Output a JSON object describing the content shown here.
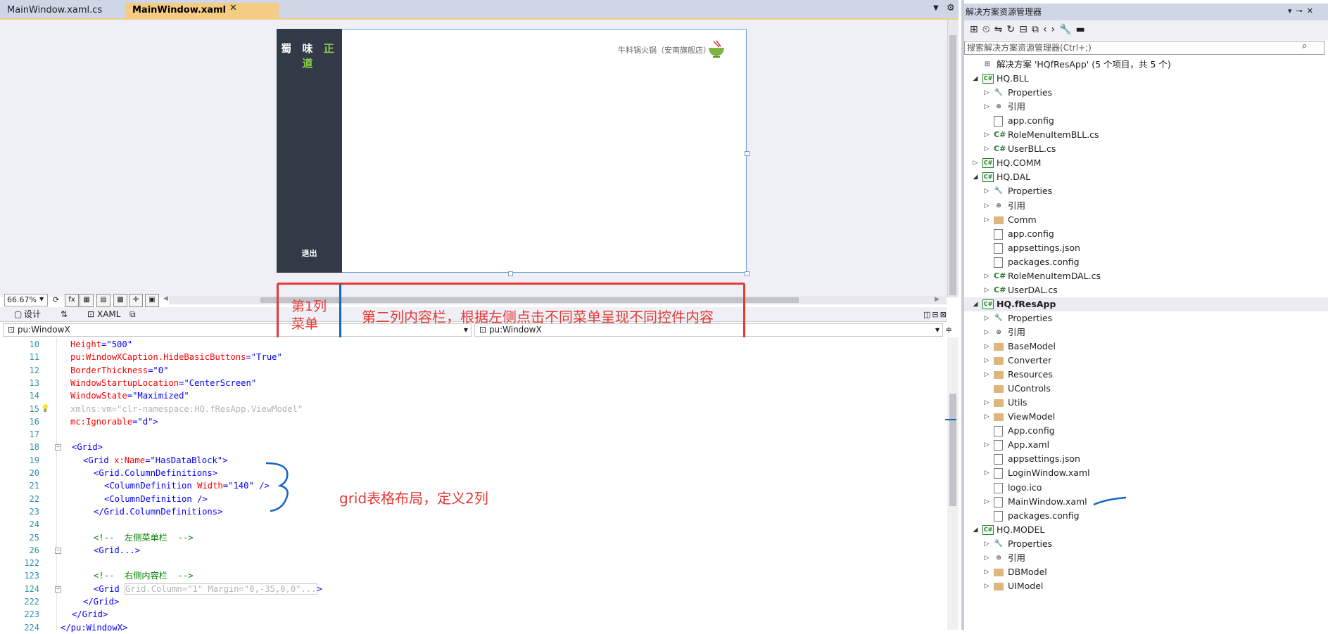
{
  "tabs": {
    "inactive_label": "MainWindow.xaml.cs",
    "active_label": "MainWindow.xaml",
    "pin_glyph": "⊸",
    "close_glyph": "✕"
  },
  "designer": {
    "brand_prefix": "蜀 味 ",
    "brand_suffix": "正 道",
    "logout_label": "退出",
    "shop_name": "牛料锅火锅（安南旗舰店）",
    "zoom": "66.67%"
  },
  "view_tabs": {
    "design_label": "设计",
    "swap_label": "⇅",
    "xaml_label": "XAML"
  },
  "dropdowns": {
    "left": "pu:WindowX",
    "right": "pu:WindowX"
  },
  "annotations": {
    "col1_line1": "第1列",
    "col1_line2": "菜单",
    "col2": "第二列内容栏，根据左侧点击不同菜单呈现不同控件内容",
    "grid_note": "grid表格布局，定义2列"
  },
  "code_lines": [
    {
      "n": "10",
      "a": "Height",
      "v": "\"500\""
    },
    {
      "n": "11",
      "a": "pu:WindowXCaption.HideBasicButtons",
      "v": "\"True\""
    },
    {
      "n": "12",
      "a": "BorderThickness",
      "v": "\"0\""
    },
    {
      "n": "13",
      "a": "WindowStartupLocation",
      "v": "\"CenterScreen\""
    },
    {
      "n": "14",
      "a": "WindowState",
      "v": "\"Maximized\""
    },
    {
      "n": "15",
      "a": "xmlns:vm",
      "v": "\"clr-namespace:HQ.fResApp.ViewModel\""
    },
    {
      "n": "16",
      "a": "mc:Ignorable",
      "v": "\"d\">"
    },
    {
      "n": "17"
    },
    {
      "n": "18",
      "t": "<Grid>"
    },
    {
      "n": "19",
      "t1": "<Grid ",
      "a": "x:Name",
      "v": "\"HasDataBlock\">"
    },
    {
      "n": "20",
      "t": "<Grid.ColumnDefinitions>"
    },
    {
      "n": "21",
      "t1": "<ColumnDefinition ",
      "a": "Width",
      "v": "\"140\" />"
    },
    {
      "n": "22",
      "t": "<ColumnDefinition />"
    },
    {
      "n": "23",
      "t": "</Grid.ColumnDefinitions>"
    },
    {
      "n": "24"
    },
    {
      "n": "25",
      "c": "<!--  左侧菜单栏  -->"
    },
    {
      "n": "26",
      "t": "<Grid...>"
    },
    {
      "n": "122"
    },
    {
      "n": "123",
      "c": "<!--  右侧内容栏  -->"
    },
    {
      "n": "124",
      "t1": "<Grid ",
      "d": "Grid.Column=\"1\" Margin=\"0,-35,0,0\"...",
      "t2": ">"
    },
    {
      "n": "222",
      "t": "</Grid>"
    },
    {
      "n": "223",
      "t": "</Grid>"
    },
    {
      "n": "224",
      "t": "</pu:WindowX>"
    }
  ],
  "solution_explorer": {
    "title": "解决方案资源管理器",
    "search_placeholder": "搜索解决方案资源管理器(Ctrl+;)",
    "tree": [
      {
        "label": "解决方案 'HQfResApp' (5 个项目，共 5 个)",
        "depth": 0,
        "arrow": "",
        "icon": "sln"
      },
      {
        "label": "HQ.BLL",
        "depth": 1,
        "arrow": "◢",
        "icon": "proj"
      },
      {
        "label": "Properties",
        "depth": 2,
        "arrow": "▷",
        "icon": "wrench"
      },
      {
        "label": "引用",
        "depth": 2,
        "arrow": "▷",
        "icon": "ref"
      },
      {
        "label": "app.config",
        "depth": 2,
        "arrow": "",
        "icon": "file"
      },
      {
        "label": "RoleMenuItemBLL.cs",
        "depth": 2,
        "arrow": "▷",
        "icon": "cs"
      },
      {
        "label": "UserBLL.cs",
        "depth": 2,
        "arrow": "▷",
        "icon": "cs"
      },
      {
        "label": "HQ.COMM",
        "depth": 1,
        "arrow": "▷",
        "icon": "proj"
      },
      {
        "label": "HQ.DAL",
        "depth": 1,
        "arrow": "◢",
        "icon": "proj"
      },
      {
        "label": "Properties",
        "depth": 2,
        "arrow": "▷",
        "icon": "wrench"
      },
      {
        "label": "引用",
        "depth": 2,
        "arrow": "▷",
        "icon": "ref"
      },
      {
        "label": "Comm",
        "depth": 2,
        "arrow": "▷",
        "icon": "folder"
      },
      {
        "label": "app.config",
        "depth": 2,
        "arrow": "",
        "icon": "file"
      },
      {
        "label": "appsettings.json",
        "depth": 2,
        "arrow": "",
        "icon": "file"
      },
      {
        "label": "packages.config",
        "depth": 2,
        "arrow": "",
        "icon": "file"
      },
      {
        "label": "RoleMenuItemDAL.cs",
        "depth": 2,
        "arrow": "▷",
        "icon": "cs"
      },
      {
        "label": "UserDAL.cs",
        "depth": 2,
        "arrow": "▷",
        "icon": "cs"
      },
      {
        "label": "HQ.fResApp",
        "depth": 1,
        "arrow": "◢",
        "icon": "proj",
        "selected": true
      },
      {
        "label": "Properties",
        "depth": 2,
        "arrow": "▷",
        "icon": "wrench"
      },
      {
        "label": "引用",
        "depth": 2,
        "arrow": "▷",
        "icon": "ref"
      },
      {
        "label": "BaseModel",
        "depth": 2,
        "arrow": "▷",
        "icon": "folder"
      },
      {
        "label": "Converter",
        "depth": 2,
        "arrow": "▷",
        "icon": "folder"
      },
      {
        "label": "Resources",
        "depth": 2,
        "arrow": "▷",
        "icon": "folder"
      },
      {
        "label": "UControls",
        "depth": 2,
        "arrow": "",
        "icon": "folder"
      },
      {
        "label": "Utils",
        "depth": 2,
        "arrow": "▷",
        "icon": "folder"
      },
      {
        "label": "ViewModel",
        "depth": 2,
        "arrow": "▷",
        "icon": "folder"
      },
      {
        "label": "App.config",
        "depth": 2,
        "arrow": "",
        "icon": "file"
      },
      {
        "label": "App.xaml",
        "depth": 2,
        "arrow": "▷",
        "icon": "file"
      },
      {
        "label": "appsettings.json",
        "depth": 2,
        "arrow": "",
        "icon": "file"
      },
      {
        "label": "LoginWindow.xaml",
        "depth": 2,
        "arrow": "▷",
        "icon": "file"
      },
      {
        "label": "logo.ico",
        "depth": 2,
        "arrow": "",
        "icon": "file"
      },
      {
        "label": "MainWindow.xaml",
        "depth": 2,
        "arrow": "▷",
        "icon": "file"
      },
      {
        "label": "packages.config",
        "depth": 2,
        "arrow": "",
        "icon": "file"
      },
      {
        "label": "HQ.MODEL",
        "depth": 1,
        "arrow": "◢",
        "icon": "proj"
      },
      {
        "label": "Properties",
        "depth": 2,
        "arrow": "▷",
        "icon": "wrench"
      },
      {
        "label": "引用",
        "depth": 2,
        "arrow": "▷",
        "icon": "ref"
      },
      {
        "label": "DBModel",
        "depth": 2,
        "arrow": "▷",
        "icon": "folder"
      },
      {
        "label": "UIModel",
        "depth": 2,
        "arrow": "▷",
        "icon": "folder"
      }
    ]
  }
}
